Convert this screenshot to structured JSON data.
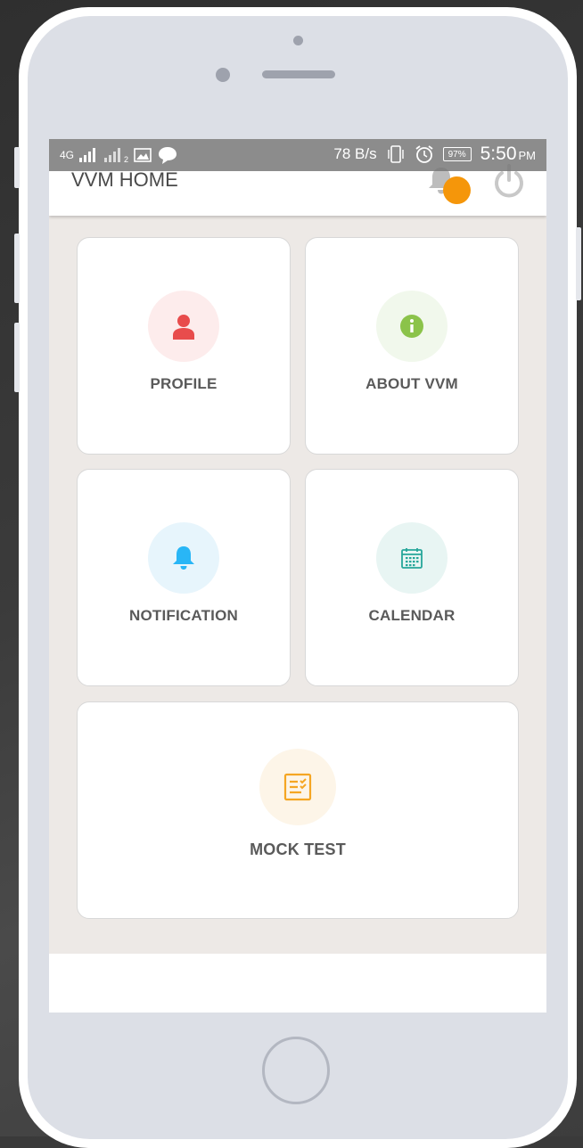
{
  "status_bar": {
    "network": "4G",
    "sim2_label": "2",
    "speed": "78 B/s",
    "battery": "97%",
    "time": "5:50",
    "ampm": "PM"
  },
  "appbar": {
    "title": "VVM HOME",
    "notification_icon": "bell-icon",
    "power_icon": "power-icon",
    "badge_color": "#f5960a"
  },
  "tiles": [
    {
      "label": "PROFILE",
      "icon": "person-icon",
      "icon_color": "#e84c4c",
      "circle_color": "#fdecec"
    },
    {
      "label": "ABOUT VVM",
      "icon": "info-icon",
      "icon_color": "#8bc34a",
      "circle_color": "#f1f8ec"
    },
    {
      "label": "NOTIFICATION",
      "icon": "bell-icon",
      "icon_color": "#29b6f6",
      "circle_color": "#e7f5fc"
    },
    {
      "label": "CALENDAR",
      "icon": "calendar-icon",
      "icon_color": "#26a69a",
      "circle_color": "#e8f5f3"
    },
    {
      "label": "MOCK TEST",
      "icon": "checklist-icon",
      "icon_color": "#f5a623",
      "circle_color": "#fdf5e8"
    }
  ]
}
